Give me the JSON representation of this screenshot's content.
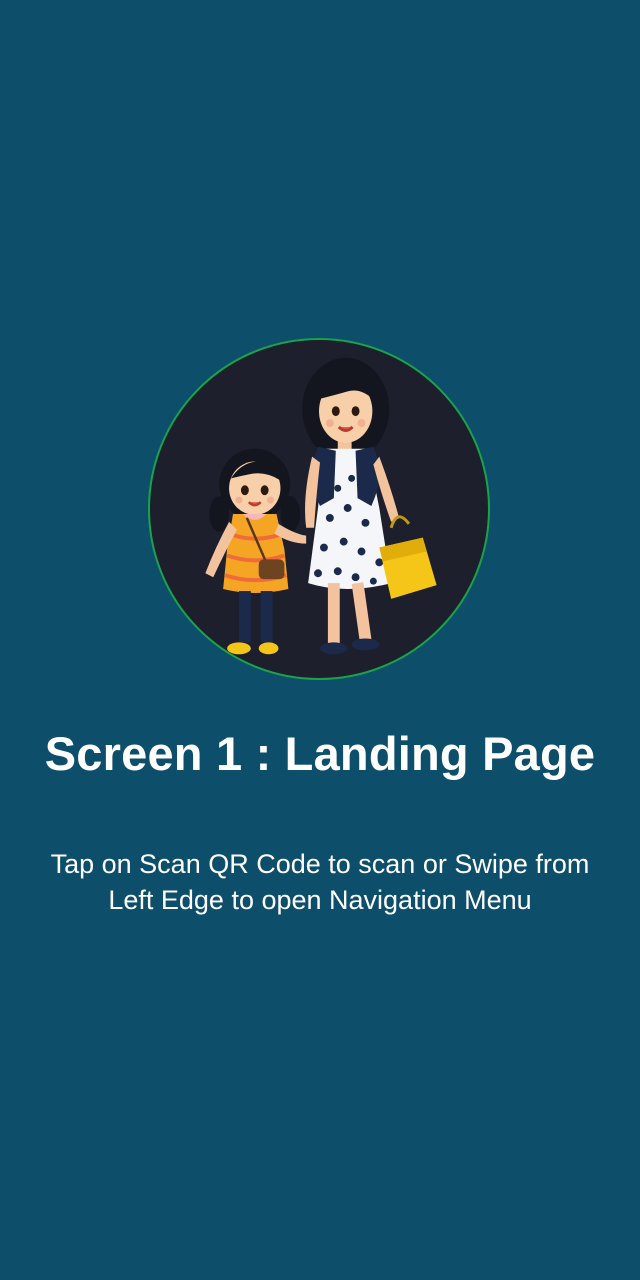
{
  "landing": {
    "title": "Screen 1 : Landing Page",
    "instruction": "Tap on Scan QR Code to scan or Swipe from Left Edge to open Navigation Menu"
  },
  "illustration": {
    "icon": "mother-and-daughter-shopping-illustration"
  },
  "colors": {
    "background": "#0d4e6b",
    "circle_fill": "#1d1f2d",
    "circle_border": "#1aa34a",
    "text": "#ffffff"
  }
}
